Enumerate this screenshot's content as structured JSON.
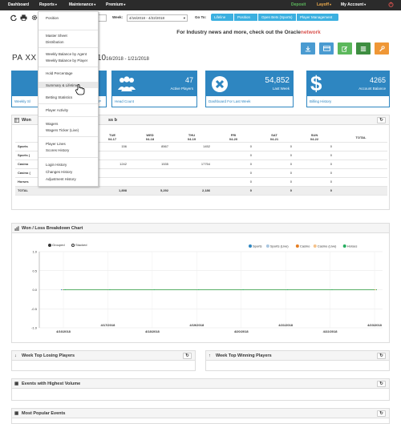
{
  "topnav": {
    "dashboard": "Dashboard",
    "reports": "Reports",
    "maintenance": "Maintenance",
    "premium": "Premium",
    "deposit": "Deposit",
    "layoff": "Layoff",
    "my_account": "My Account",
    "deposit_color": "#5cb85c",
    "layoff_color": "#f0ad4e",
    "power_color": "#d9534f"
  },
  "toolbar": {
    "week_label": "Week:",
    "week_value": "4/16/2018 - 4/22/2018",
    "goto_label": "Go To:",
    "goto_links": [
      "Lifeline",
      "Position",
      "Open Bets (Sports)",
      "Player Management"
    ]
  },
  "banner": {
    "text": "For Industry news and more, check out the",
    "brand": "Oracle",
    "brand_suffix": "network"
  },
  "page": {
    "agent_prefix": "PA XX",
    "date_range_prefix": "10",
    "date_range": "16/2018 - 1/21/2018"
  },
  "stats": [
    {
      "label": "Weekly Sl",
      "footer": "Weekly Sl",
      "value": ""
    },
    {
      "label": "",
      "footer": "by P",
      "value": ""
    },
    {
      "value": "47",
      "label": "Active Players",
      "footer": "Head Count"
    },
    {
      "value": "54,852",
      "label": "Last Week",
      "footer": "Dashboard For Last Week"
    },
    {
      "value": "4265",
      "label": "Account Balance",
      "footer": "Billing History"
    }
  ],
  "wl_panel": {
    "title": "Won",
    "title_suffix": "ss b"
  },
  "wl_table": {
    "headers": [
      {
        "day": "",
        "date": ""
      },
      {
        "day": "",
        "date": ""
      },
      {
        "day": "TUE",
        "date": "04-17"
      },
      {
        "day": "WED",
        "date": "04-18"
      },
      {
        "day": "THU",
        "date": "04-19"
      },
      {
        "day": "FRI",
        "date": "04-20"
      },
      {
        "day": "SAT",
        "date": "04-21"
      },
      {
        "day": "SUN",
        "date": "04-22"
      },
      {
        "day": "TOTAL",
        "date": ""
      }
    ],
    "rows": [
      {
        "label": "Sports",
        "cells": [
          "",
          "156",
          "8567",
          "1452",
          "0",
          "0",
          "0",
          ""
        ]
      },
      {
        "label": "Sports (",
        "cells": [
          "",
          "",
          "",
          "",
          "0",
          "0",
          "0",
          ""
        ]
      },
      {
        "label": "Casino",
        "cells": [
          "",
          "1242",
          "1535",
          "17754",
          "0",
          "0",
          "0",
          ""
        ]
      },
      {
        "label": "Casino (",
        "cells": [
          "",
          "",
          "",
          "",
          "0",
          "0",
          "0",
          ""
        ]
      },
      {
        "label": "Horses",
        "cells": [
          "",
          "",
          "",
          "",
          "0",
          "0",
          "0",
          ""
        ]
      },
      {
        "label": "TOTAL",
        "cells": [
          "",
          "1,898",
          "5,292",
          "2,186",
          "0",
          "0",
          "0",
          ""
        ]
      }
    ]
  },
  "chart_panel": {
    "title": "Won / Loss Breakdown Chart",
    "grouped_label": "Grouped",
    "stacked_label": "Stacked"
  },
  "chart_data": {
    "type": "line",
    "x": [
      "4/16/2018",
      "4/17/2018",
      "4/18/2018",
      "4/19/2018",
      "4/20/2018",
      "4/21/2018",
      "4/22/2018",
      "4/23/2018"
    ],
    "x_tick_labels": [
      "4/16/2018",
      "4/17/2018",
      "4/18/2018",
      "4/19/2018",
      "4/20/2018",
      "4/21/2018",
      "4/22/2018",
      "4/23/2018"
    ],
    "series": [
      {
        "name": "Sports",
        "color": "#2e86c1",
        "values": [
          0,
          0,
          0,
          0,
          0,
          0,
          0,
          0
        ]
      },
      {
        "name": "Sports (Live)",
        "color": "#a9c6e0",
        "values": [
          0,
          0,
          0,
          0,
          0,
          0,
          0,
          0
        ]
      },
      {
        "name": "Casino",
        "color": "#e67e22",
        "values": [
          0,
          0,
          0,
          0,
          0,
          0,
          0,
          0
        ]
      },
      {
        "name": "Casino (Live)",
        "color": "#f5c28a",
        "values": [
          0,
          0,
          0,
          0,
          0,
          0,
          0,
          0
        ]
      },
      {
        "name": "Horses",
        "color": "#27ae60",
        "values": [
          0,
          0,
          0,
          0,
          0,
          0,
          0,
          0
        ]
      }
    ],
    "y_ticks": [
      "1.0",
      "0.5",
      "0.0",
      "-0.5",
      "-1.0"
    ],
    "ylim": [
      -1.0,
      1.0
    ],
    "grid": true,
    "legend_placement": "top-right"
  },
  "panels": {
    "losing": "Week Top Losing Players",
    "winning": "Week Top Winning Players",
    "volume": "Events with Highest Volume",
    "popular": "Most Popular Events"
  },
  "dropdown": {
    "items": [
      "Position",
      "Master Sheet",
      "Distribution",
      "Weekly Balance by Agent",
      "Weekly Balance by Player",
      "Hold Percentage",
      "Summary & Lifetime",
      "Betting Statistics",
      "Player Activity",
      "Wagers",
      "Wagers Ticker (Live)",
      "Player Lines",
      "Scores History",
      "Login History",
      "Changes History",
      "Adjustment History"
    ]
  }
}
